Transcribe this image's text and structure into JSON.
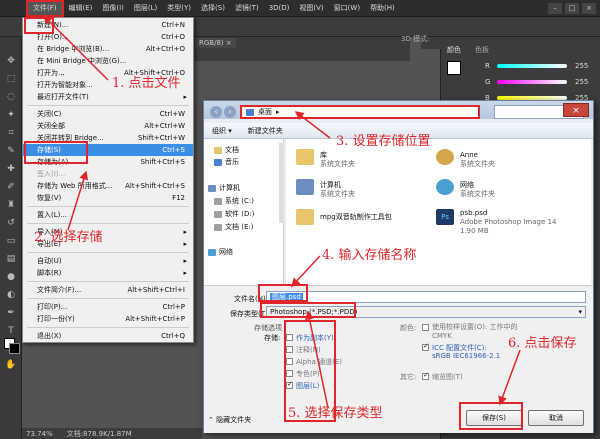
{
  "menubar": {
    "items": [
      "文件(F)",
      "编辑(E)",
      "图像(I)",
      "图层(L)",
      "类型(Y)",
      "选择(S)",
      "滤镜(T)",
      "3D(D)",
      "视图(V)",
      "窗口(W)",
      "帮助(H)"
    ]
  },
  "canvas_tab": "RGB/8) ×",
  "file_menu": {
    "items": [
      {
        "label": "新建(N)...",
        "shortcut": "Ctrl+N"
      },
      {
        "label": "打开(O)...",
        "shortcut": "Ctrl+O"
      },
      {
        "label": "在 Bridge 中浏览(B)...",
        "shortcut": "Alt+Ctrl+O"
      },
      {
        "label": "在 Mini Bridge 中浏览(G)...",
        "shortcut": ""
      },
      {
        "label": "打开为...",
        "shortcut": "Alt+Shift+Ctrl+O"
      },
      {
        "label": "打开为智能对象...",
        "shortcut": ""
      },
      {
        "label": "最近打开文件(T)",
        "shortcut": ""
      },
      {
        "label": "关闭(C)",
        "shortcut": "Ctrl+W"
      },
      {
        "label": "关闭全部",
        "shortcut": "Alt+Ctrl+W"
      },
      {
        "label": "关闭并转到 Bridge...",
        "shortcut": "Shift+Ctrl+W"
      },
      {
        "label": "存储(S)",
        "shortcut": "Ctrl+S"
      },
      {
        "label": "存储为(A)...",
        "shortcut": "Shift+Ctrl+S"
      },
      {
        "label": "签入(I)...",
        "shortcut": ""
      },
      {
        "label": "存储为 Web 所用格式...",
        "shortcut": "Alt+Shift+Ctrl+S"
      },
      {
        "label": "恢复(V)",
        "shortcut": "F12"
      },
      {
        "label": "置入(L)...",
        "shortcut": ""
      },
      {
        "label": "导入(M)",
        "shortcut": ""
      },
      {
        "label": "导出(E)",
        "shortcut": ""
      },
      {
        "label": "自动(U)",
        "shortcut": ""
      },
      {
        "label": "脚本(R)",
        "shortcut": ""
      },
      {
        "label": "文件简介(F)...",
        "shortcut": "Alt+Shift+Ctrl+I"
      },
      {
        "label": "打印(P)...",
        "shortcut": "Ctrl+P"
      },
      {
        "label": "打印一份(Y)",
        "shortcut": "Alt+Shift+Ctrl+P"
      },
      {
        "label": "退出(X)",
        "shortcut": "Ctrl+Q"
      }
    ]
  },
  "dialog": {
    "address": "桌面",
    "address_arrow": "▸",
    "organize": "组织 ▾",
    "new_folder": "新建文件夹",
    "nav": [
      {
        "label": "文档",
        "color": "#e8c46a"
      },
      {
        "label": "音乐",
        "color": "#4a7fd1"
      },
      {
        "label": "计算机",
        "color": "#6a8fc0"
      },
      {
        "label": "系统 (C:)",
        "color": "#a0a0a0"
      },
      {
        "label": "软件 (D:)",
        "color": "#a0a0a0"
      },
      {
        "label": "文档 (E:)",
        "color": "#a0a0a0"
      },
      {
        "label": "网络",
        "color": "#4a9fd1"
      }
    ],
    "files": [
      {
        "name": "库",
        "sub": "系统文件夹",
        "color": "#e8c46a"
      },
      {
        "name": "Anne",
        "sub": "系统文件夹",
        "color": "#d4a84a"
      },
      {
        "name": "计算机",
        "sub": "系统文件夹",
        "color": "#6a8fc0"
      },
      {
        "name": "网络",
        "sub": "系统文件夹",
        "color": "#4a9fd1"
      },
      {
        "name": "mpg双音轨制作工具包",
        "sub": "",
        "color": "#e8c46a"
      },
      {
        "name": "psb.psd",
        "sub": "Adobe Photoshop Image 14",
        "sub2": "1.90 MB",
        "color": "#1d3a66"
      }
    ],
    "filename_label": "文件名(N):",
    "filename_value": "图层.psd",
    "filetype_label": "保存类型(T):",
    "filetype_value": "Photoshop (*.PSD;*.PDD)",
    "save_options": "存储选项",
    "store_label": "存储:",
    "opt_copy": "作为副本(Y)",
    "opt_notes": "注释(N)",
    "opt_alpha": "Alpha 通道(E)",
    "opt_spot": "专色(P)",
    "opt_layers": "图层(L)",
    "color_label": "颜色:",
    "color_proof": "使用校样设置(O): 工作中的 CMYK",
    "icc": "ICC 配置文件(C):",
    "icc_value": "sRGB IEC61966-2.1",
    "other_label": "其它:",
    "thumbnail": "缩览图(T)",
    "hide_folders": "隐藏文件夹",
    "save_btn": "保存(S)",
    "cancel_btn": "取消"
  },
  "annotations": {
    "a1": "1. 点击文件",
    "a2": "2. 选择存储",
    "a3": "3. 设置存储位置",
    "a4": "4. 输入存储名称",
    "a5": "5. 选择保存类型",
    "a6": "6. 点击保存"
  },
  "right_panel": {
    "tab1": "颜色",
    "tab2": "色板",
    "channels": [
      {
        "label": "R",
        "value": "255",
        "color": "#e04040"
      },
      {
        "label": "G",
        "value": "255",
        "color": "#40c040"
      },
      {
        "label": "B",
        "value": "255",
        "color": "#4060e0"
      }
    ],
    "mode": "3D 模式:"
  },
  "status": {
    "zoom": "73.74%",
    "doc": "文档:878.9K/1.87M"
  },
  "accent_red": "#e0262a"
}
